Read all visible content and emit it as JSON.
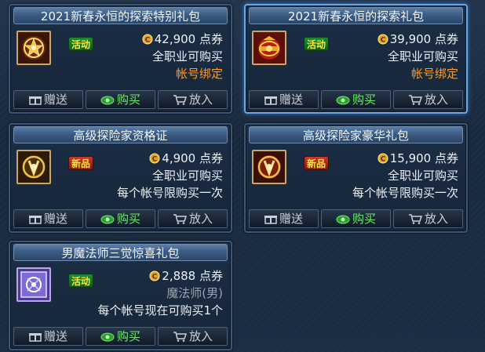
{
  "buttons": {
    "gift": "赠送",
    "buy": "购买",
    "cart": "放入"
  },
  "accent": {
    "price_orange": "#ff9a22",
    "buy_green": "#6fe66f",
    "selected_border": "#6ea6de"
  },
  "items": [
    {
      "title": "2021新春永恒的探索特别礼包",
      "badge": "活动",
      "badge_type": "act",
      "price": "42,900 点券",
      "lines": [
        "全职业可购买"
      ],
      "binding": "帐号绑定",
      "icon": "golden-orb-icon",
      "selected": false
    },
    {
      "title": "2021新春永恒的探索礼包",
      "badge": "活动",
      "badge_type": "act",
      "price": "39,900 点券",
      "lines": [
        "全职业可购买"
      ],
      "binding": "帐号绑定",
      "icon": "red-orb-icon",
      "selected": true
    },
    {
      "title": "高级探险家资格证",
      "badge": "新品",
      "badge_type": "new",
      "price": "4,900 点券",
      "lines": [
        "全职业可购买",
        "每个帐号限购买一次"
      ],
      "binding": "",
      "icon": "adventurer-emblem-icon",
      "selected": false
    },
    {
      "title": "高级探险家豪华礼包",
      "badge": "新品",
      "badge_type": "new",
      "price": "15,900 点券",
      "lines": [
        "全职业可购买",
        "每个帐号限购买一次"
      ],
      "binding": "",
      "icon": "adventurer-emblem-icon",
      "selected": false
    },
    {
      "title": "男魔法师三觉惊喜礼包",
      "badge": "活动",
      "badge_type": "act",
      "price": "2,888 点券",
      "lines": [
        "魔法师(男)",
        "每个帐号现在可购买1个"
      ],
      "binding": "",
      "icon": "purple-sigil-icon",
      "selected": false
    }
  ]
}
